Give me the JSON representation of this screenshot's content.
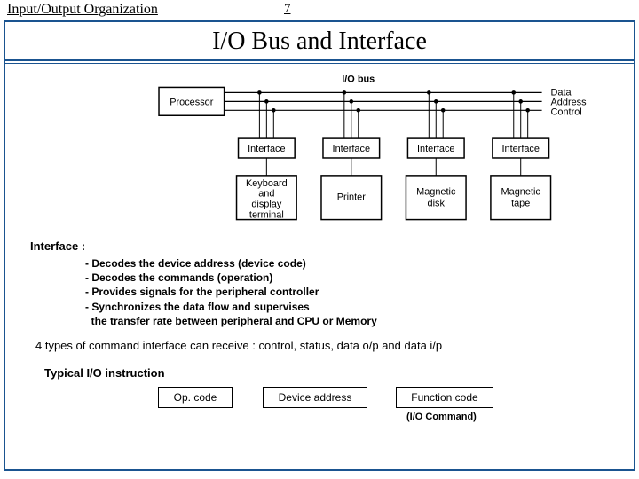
{
  "header": {
    "left": "Input/Output Organization",
    "page": "7"
  },
  "title": "I/O Bus and Interface",
  "bus_label": "I/O bus",
  "processor": "Processor",
  "bus_lines": [
    "Data",
    "Address",
    "Control"
  ],
  "interfaces": [
    "Interface",
    "Interface",
    "Interface",
    "Interface"
  ],
  "devices": [
    {
      "l1": "Keyboard",
      "l2": "and",
      "l3": "display",
      "l4": "terminal"
    },
    {
      "l1": "Printer"
    },
    {
      "l1": "Magnetic",
      "l2": "disk"
    },
    {
      "l1": "Magnetic",
      "l2": "tape"
    }
  ],
  "section_heading": "Interface :",
  "bullets": [
    "- Decodes the device address (device code)",
    "- Decodes the commands (operation)",
    "- Provides signals for the peripheral controller",
    "- Synchronizes the data flow and supervises",
    "  the transfer rate between peripheral and CPU or Memory"
  ],
  "types_note": "4 types of command interface can receive : control, status, data o/p and data i/p",
  "typical_heading": "Typical I/O instruction",
  "instr": {
    "op": "Op. code",
    "dev": "Device address",
    "fn": "Function code",
    "caption": "(I/O Command)"
  }
}
